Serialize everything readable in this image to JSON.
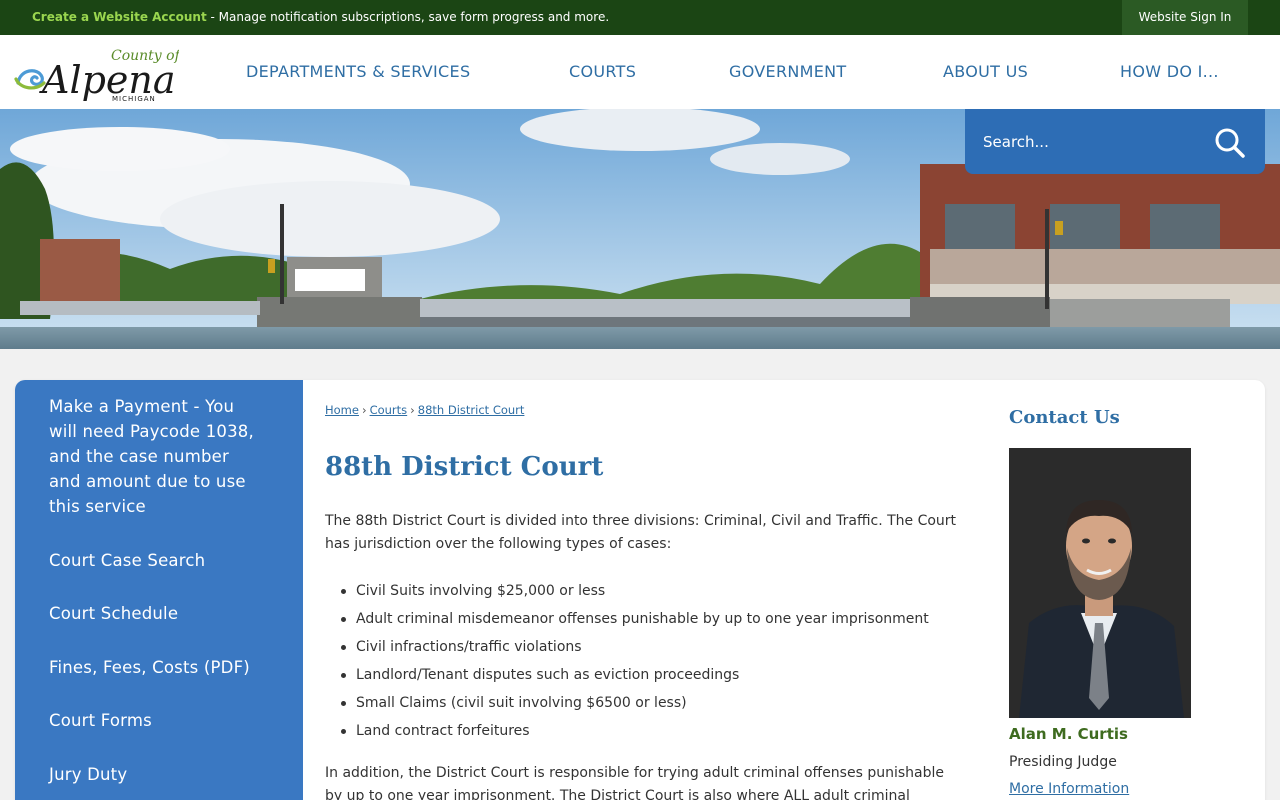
{
  "topbar": {
    "create_account_link": "Create a Website Account",
    "create_account_desc": " - Manage notification subscriptions, save form progress and more.",
    "sign_in": "Website Sign In"
  },
  "logo": {
    "county_of": "County of",
    "name": "Alpena",
    "state": "MICHIGAN"
  },
  "nav": [
    {
      "label": "DEPARTMENTS & SERVICES"
    },
    {
      "label": "COURTS"
    },
    {
      "label": "GOVERNMENT"
    },
    {
      "label": "ABOUT US"
    },
    {
      "label": "HOW DO I..."
    }
  ],
  "search": {
    "placeholder": "Search..."
  },
  "sidebar": {
    "items": [
      {
        "label": "Make a Payment - You will need Paycode 1038, and the case number and amount due to use this service"
      },
      {
        "label": "Court Case Search"
      },
      {
        "label": "Court Schedule"
      },
      {
        "label": "Fines, Fees, Costs (PDF)"
      },
      {
        "label": "Court Forms"
      },
      {
        "label": "Jury Duty"
      }
    ]
  },
  "breadcrumb": [
    "Home",
    "Courts",
    "88th District Court"
  ],
  "page": {
    "title": "88th District Court",
    "intro": "The 88th District Court is divided into three divisions: Criminal, Civil and Traffic. The Court has jurisdiction over the following types of cases:",
    "cases": [
      "Civil Suits involving $25,000 or less",
      "Adult criminal misdemeanor offenses punishable by up to one year imprisonment",
      "Civil infractions/traffic violations",
      "Landlord/Tenant disputes such as eviction proceedings",
      "Small Claims (civil suit involving $6500 or less)",
      "Land contract forfeitures"
    ],
    "outro": "In addition, the District Court is responsible for trying adult criminal offenses punishable by up to one year imprisonment. The District Court is also where ALL adult criminal"
  },
  "contact": {
    "heading": "Contact Us",
    "name": "Alan M. Curtis",
    "role": "Presiding Judge",
    "link": "More Information"
  },
  "colors": {
    "topbar": "#1b4514",
    "accent_green": "#9ad64f",
    "nav_blue": "#2f6ea4",
    "sidebar_blue": "#3a78c2",
    "search_blue": "#2d6db5"
  }
}
